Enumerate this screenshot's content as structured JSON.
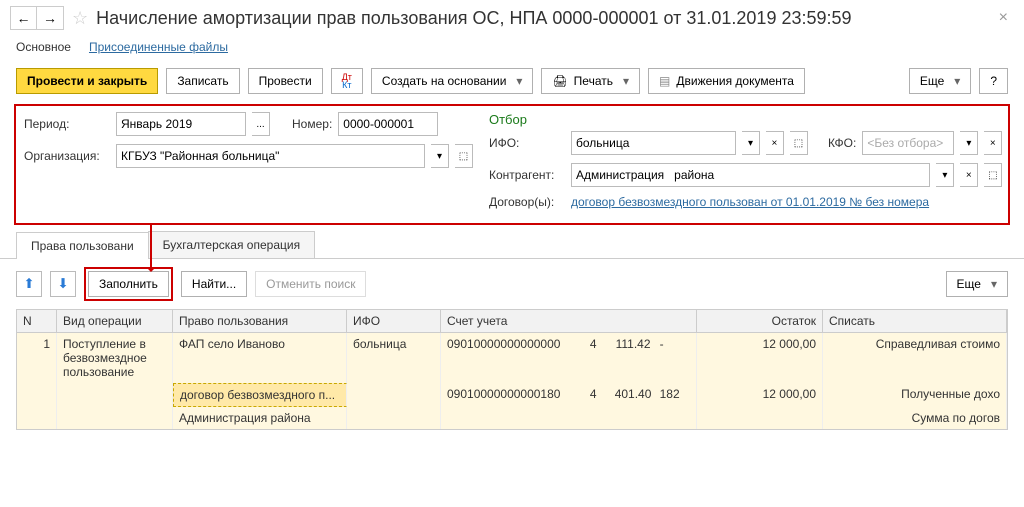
{
  "header": {
    "title": "Начисление амортизации прав пользования ОС, НПА 0000-000001 от 31.01.2019 23:59:59"
  },
  "subnav": {
    "main": "Основное",
    "attached": "Присоединенные файлы"
  },
  "toolbar": {
    "post_close": "Провести и закрыть",
    "save": "Записать",
    "post": "Провести",
    "create_based": "Создать на основании",
    "print": "Печать",
    "movements": "Движения документа",
    "more": "Еще"
  },
  "form": {
    "period_label": "Период:",
    "period_value": "Январь 2019",
    "number_label": "Номер:",
    "number_value": "0000-000001",
    "org_label": "Организация:",
    "org_value": "КГБУЗ \"Районная больница\""
  },
  "filter": {
    "title": "Отбор",
    "ifo_label": "ИФО:",
    "ifo_value": "больница",
    "kfo_label": "КФО:",
    "kfo_placeholder": "<Без отбора>",
    "counterparty_label": "Контрагент:",
    "counterparty_value": "Администрация   района",
    "contracts_label": "Договор(ы):",
    "contracts_value": "договор безвозмездного пользован от 01.01.2019 № без номера"
  },
  "tabs": {
    "rights": "Права пользовани",
    "accounting": "Бухгалтерская операция"
  },
  "subtoolbar": {
    "fill": "Заполнить",
    "find": "Найти...",
    "cancel_search": "Отменить поиск",
    "more": "Еще"
  },
  "grid": {
    "headers": {
      "n": "N",
      "op": "Вид операции",
      "right": "Право пользования",
      "ifo": "ИФО",
      "account": "Счет учета",
      "remainder": "Остаток",
      "write": "Списать"
    },
    "rows": [
      {
        "n": "1",
        "op": "Поступление в безвозмездное пользование",
        "right": "ФАП село Иваново",
        "ifo": "больница",
        "acct": "09010000000000000",
        "a": "4",
        "b": "111.42",
        "c": "-",
        "rem": "12 000,00",
        "write": "Справедливая стоимо"
      },
      {
        "right": "договор безвозмездного п...",
        "acct": "09010000000000180",
        "a": "4",
        "b": "401.40",
        "c": "182",
        "rem": "12 000,00",
        "write": "Полученные дохо"
      },
      {
        "right": "Администрация   района",
        "write": "Сумма по догов"
      }
    ]
  }
}
